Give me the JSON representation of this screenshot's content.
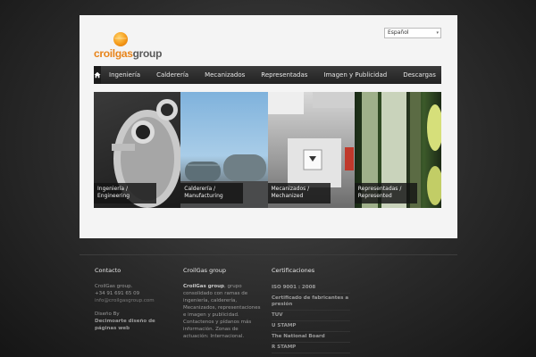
{
  "header": {
    "logo": {
      "part1": "croilgas",
      "part2": "group"
    },
    "language": {
      "selected": "Español"
    }
  },
  "nav": {
    "items": [
      "Ingeniería",
      "Calderería",
      "Mecanizados",
      "Representadas",
      "Imagen y Publicidad",
      "Descargas"
    ]
  },
  "tiles": [
    {
      "line1": "Ingeniería /",
      "line2": "Engineering"
    },
    {
      "line1": "Calderería /",
      "line2": "Manufacturing"
    },
    {
      "line1": "Mecanizados /",
      "line2": "Mechanized"
    },
    {
      "line1": "Representadas /",
      "line2": "Represented"
    }
  ],
  "footer": {
    "contact": {
      "title": "Contacto",
      "name": "CroilGas group.",
      "phone": "+34 91 691 65 09",
      "email": "info@croilgasgroup.com",
      "design_by": "Diseño By",
      "designer": "Decimoarte diseño de páginas web"
    },
    "about": {
      "title": "CroilGas group",
      "bold": "CroilGas group",
      "text": ", grupo consolidado con ramas de ingeniería, calderería, Mecanizados, representaciones e imagen y publicidad. Contactenos y pídanos más información. Zonas de actuación: Internacional."
    },
    "certs": {
      "title": "Certificaciones",
      "items": [
        "ISO 9001 : 2008",
        "Certificado de fabricantes a presión",
        "TUV",
        "U STAMP",
        "The National Board",
        "R STAMP"
      ]
    }
  }
}
